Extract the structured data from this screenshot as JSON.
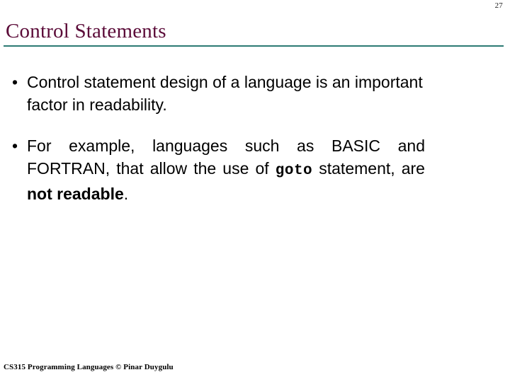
{
  "slide": {
    "page_number": "27",
    "title": "Control Statements",
    "accent_color_title": "#5b0b38",
    "accent_color_rule": "#2c7a73",
    "background_color": "#ffffff",
    "bullets": [
      {
        "marker": "•",
        "text": "Control statement design of a language is an important factor in readability."
      },
      {
        "marker": "•",
        "segment_1": "For example, languages such as BASIC and FORTRAN, that allow the use of ",
        "segment_code": "goto",
        "segment_2": " statement, are ",
        "segment_bold": "not readable",
        "segment_3": "."
      }
    ],
    "footer": "CS315 Programming Languages © Pinar Duygulu"
  }
}
